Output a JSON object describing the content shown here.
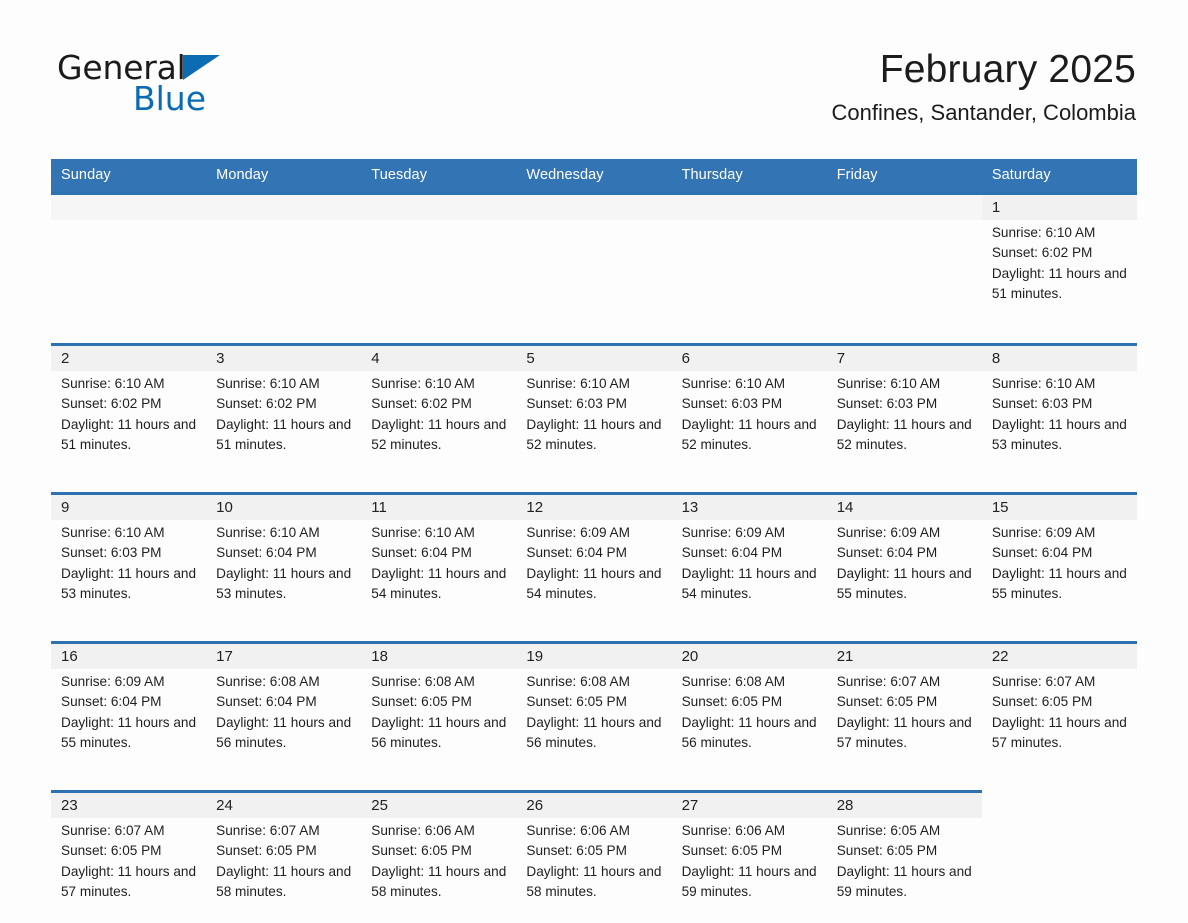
{
  "branding": {
    "logo_word_1": "General",
    "logo_word_2": "Blue",
    "logo_triangle_color": "#0b6cb3",
    "logo_blue_color": "#0b6cb3"
  },
  "header": {
    "title": "February 2025",
    "subtitle": "Confines, Santander, Colombia"
  },
  "theme": {
    "header_bg": "#3375b4",
    "header_text": "#ffffff",
    "row_rule": "#2e71b0",
    "daynum_bg": "#f1f1f1",
    "page_bg": "#fdfdfd",
    "body_text": "#1f1f1f"
  },
  "columns": [
    "Sunday",
    "Monday",
    "Tuesday",
    "Wednesday",
    "Thursday",
    "Friday",
    "Saturday"
  ],
  "labels": {
    "sunrise_prefix": "Sunrise:",
    "sunset_prefix": "Sunset:",
    "daylight_prefix": "Daylight:"
  },
  "weeks": [
    [
      {
        "day": "",
        "empty": true
      },
      {
        "day": "",
        "empty": true
      },
      {
        "day": "",
        "empty": true
      },
      {
        "day": "",
        "empty": true
      },
      {
        "day": "",
        "empty": true
      },
      {
        "day": "",
        "empty": true
      },
      {
        "day": "1",
        "sunrise": "Sunrise: 6:10 AM",
        "sunset": "Sunset: 6:02 PM",
        "daylight": "Daylight: 11 hours and 51 minutes."
      }
    ],
    [
      {
        "day": "2",
        "sunrise": "Sunrise: 6:10 AM",
        "sunset": "Sunset: 6:02 PM",
        "daylight": "Daylight: 11 hours and 51 minutes."
      },
      {
        "day": "3",
        "sunrise": "Sunrise: 6:10 AM",
        "sunset": "Sunset: 6:02 PM",
        "daylight": "Daylight: 11 hours and 51 minutes."
      },
      {
        "day": "4",
        "sunrise": "Sunrise: 6:10 AM",
        "sunset": "Sunset: 6:02 PM",
        "daylight": "Daylight: 11 hours and 52 minutes."
      },
      {
        "day": "5",
        "sunrise": "Sunrise: 6:10 AM",
        "sunset": "Sunset: 6:03 PM",
        "daylight": "Daylight: 11 hours and 52 minutes."
      },
      {
        "day": "6",
        "sunrise": "Sunrise: 6:10 AM",
        "sunset": "Sunset: 6:03 PM",
        "daylight": "Daylight: 11 hours and 52 minutes."
      },
      {
        "day": "7",
        "sunrise": "Sunrise: 6:10 AM",
        "sunset": "Sunset: 6:03 PM",
        "daylight": "Daylight: 11 hours and 52 minutes."
      },
      {
        "day": "8",
        "sunrise": "Sunrise: 6:10 AM",
        "sunset": "Sunset: 6:03 PM",
        "daylight": "Daylight: 11 hours and 53 minutes."
      }
    ],
    [
      {
        "day": "9",
        "sunrise": "Sunrise: 6:10 AM",
        "sunset": "Sunset: 6:03 PM",
        "daylight": "Daylight: 11 hours and 53 minutes."
      },
      {
        "day": "10",
        "sunrise": "Sunrise: 6:10 AM",
        "sunset": "Sunset: 6:04 PM",
        "daylight": "Daylight: 11 hours and 53 minutes."
      },
      {
        "day": "11",
        "sunrise": "Sunrise: 6:10 AM",
        "sunset": "Sunset: 6:04 PM",
        "daylight": "Daylight: 11 hours and 54 minutes."
      },
      {
        "day": "12",
        "sunrise": "Sunrise: 6:09 AM",
        "sunset": "Sunset: 6:04 PM",
        "daylight": "Daylight: 11 hours and 54 minutes."
      },
      {
        "day": "13",
        "sunrise": "Sunrise: 6:09 AM",
        "sunset": "Sunset: 6:04 PM",
        "daylight": "Daylight: 11 hours and 54 minutes."
      },
      {
        "day": "14",
        "sunrise": "Sunrise: 6:09 AM",
        "sunset": "Sunset: 6:04 PM",
        "daylight": "Daylight: 11 hours and 55 minutes."
      },
      {
        "day": "15",
        "sunrise": "Sunrise: 6:09 AM",
        "sunset": "Sunset: 6:04 PM",
        "daylight": "Daylight: 11 hours and 55 minutes."
      }
    ],
    [
      {
        "day": "16",
        "sunrise": "Sunrise: 6:09 AM",
        "sunset": "Sunset: 6:04 PM",
        "daylight": "Daylight: 11 hours and 55 minutes."
      },
      {
        "day": "17",
        "sunrise": "Sunrise: 6:08 AM",
        "sunset": "Sunset: 6:04 PM",
        "daylight": "Daylight: 11 hours and 56 minutes."
      },
      {
        "day": "18",
        "sunrise": "Sunrise: 6:08 AM",
        "sunset": "Sunset: 6:05 PM",
        "daylight": "Daylight: 11 hours and 56 minutes."
      },
      {
        "day": "19",
        "sunrise": "Sunrise: 6:08 AM",
        "sunset": "Sunset: 6:05 PM",
        "daylight": "Daylight: 11 hours and 56 minutes."
      },
      {
        "day": "20",
        "sunrise": "Sunrise: 6:08 AM",
        "sunset": "Sunset: 6:05 PM",
        "daylight": "Daylight: 11 hours and 56 minutes."
      },
      {
        "day": "21",
        "sunrise": "Sunrise: 6:07 AM",
        "sunset": "Sunset: 6:05 PM",
        "daylight": "Daylight: 11 hours and 57 minutes."
      },
      {
        "day": "22",
        "sunrise": "Sunrise: 6:07 AM",
        "sunset": "Sunset: 6:05 PM",
        "daylight": "Daylight: 11 hours and 57 minutes."
      }
    ],
    [
      {
        "day": "23",
        "sunrise": "Sunrise: 6:07 AM",
        "sunset": "Sunset: 6:05 PM",
        "daylight": "Daylight: 11 hours and 57 minutes."
      },
      {
        "day": "24",
        "sunrise": "Sunrise: 6:07 AM",
        "sunset": "Sunset: 6:05 PM",
        "daylight": "Daylight: 11 hours and 58 minutes."
      },
      {
        "day": "25",
        "sunrise": "Sunrise: 6:06 AM",
        "sunset": "Sunset: 6:05 PM",
        "daylight": "Daylight: 11 hours and 58 minutes."
      },
      {
        "day": "26",
        "sunrise": "Sunrise: 6:06 AM",
        "sunset": "Sunset: 6:05 PM",
        "daylight": "Daylight: 11 hours and 58 minutes."
      },
      {
        "day": "27",
        "sunrise": "Sunrise: 6:06 AM",
        "sunset": "Sunset: 6:05 PM",
        "daylight": "Daylight: 11 hours and 59 minutes."
      },
      {
        "day": "28",
        "sunrise": "Sunrise: 6:05 AM",
        "sunset": "Sunset: 6:05 PM",
        "daylight": "Daylight: 11 hours and 59 minutes."
      },
      {
        "day": "",
        "empty": true
      }
    ]
  ]
}
